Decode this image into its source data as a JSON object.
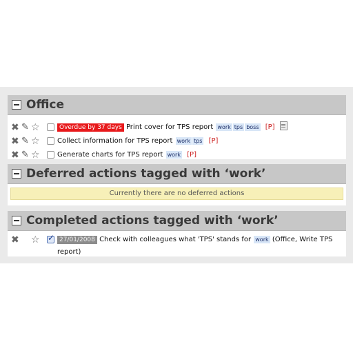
{
  "sections": {
    "office": {
      "title": "Office",
      "actions": [
        {
          "overdue": "Overdue by 37 days",
          "text": "Print cover for TPS report",
          "tags": [
            "work",
            "tps",
            "boss"
          ],
          "project_marker": "[P]",
          "has_note": true
        },
        {
          "text": "Collect information for TPS report",
          "tags": [
            "work",
            "tps"
          ],
          "project_marker": "[P]"
        },
        {
          "text": "Generate charts for TPS report",
          "tags": [
            "work"
          ],
          "project_marker": "[P]"
        }
      ]
    },
    "deferred": {
      "title": "Deferred actions tagged with ‘work’",
      "empty_message": "Currently there are no deferred actions"
    },
    "completed": {
      "title": "Completed actions tagged with ‘work’",
      "actions": [
        {
          "date": "27/01/2008",
          "text": "Check with colleagues what 'TPS' stands for",
          "tag": "work",
          "context_line1": "(Office, Write TPS",
          "context_line2": "report)"
        }
      ]
    }
  },
  "icons": {
    "delete": "delete-x-icon",
    "edit": "pencil-icon",
    "star": "star-icon",
    "note": "note-icon",
    "collapse": "collapse-minus-icon"
  },
  "colors": {
    "overdue_badge": "#e8191b",
    "tag_bg": "#d8e6f7",
    "project_marker": "#cc2020",
    "empty_message_bg": "#f7f0b8",
    "section_header": "#c7c7c7"
  }
}
